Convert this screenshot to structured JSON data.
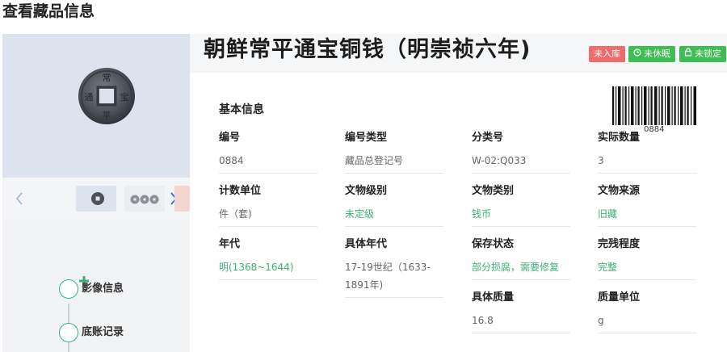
{
  "page": {
    "title": "查看藏品信息"
  },
  "item": {
    "title": "朝鲜常平通宝铜钱（明崇祯六年)",
    "badges": [
      {
        "label": "未入库",
        "color": "#f06b6b"
      },
      {
        "label": "未休眠",
        "color": "#3dbd53",
        "icon": "clock-icon"
      },
      {
        "label": "未锁定",
        "color": "#3dbd53",
        "icon": "lock-icon"
      }
    ]
  },
  "gallery": {
    "prev_icon": "chevron-left-icon",
    "next_icon": "chevron-right-icon"
  },
  "timeline": {
    "add_icon": "plus-icon",
    "items": [
      {
        "label": "影像信息"
      },
      {
        "label": "底账记录"
      }
    ]
  },
  "basic_info": {
    "section_title": "基本信息",
    "barcode_number": "0884",
    "fields": [
      {
        "label": "编号",
        "value": "0884"
      },
      {
        "label": "编号类型",
        "value": "藏品总登记号"
      },
      {
        "label": "分类号",
        "value": "W-02:Q033"
      },
      {
        "label": "实际数量",
        "value": "3"
      },
      {
        "label": "计数单位",
        "value": "件（套)"
      },
      {
        "label": "文物级别",
        "value": "未定级"
      },
      {
        "label": "文物类别",
        "value": "钱币"
      },
      {
        "label": "文物来源",
        "value": "旧藏"
      },
      {
        "label": "年代",
        "value": "明(1368~1644)"
      },
      {
        "label": "具体年代",
        "value": "17-19世纪（1633-1891年)"
      },
      {
        "label": "保存状态",
        "value": "部分损腐，需要修复"
      },
      {
        "label": "完残程度",
        "value": "完整"
      },
      {
        "label": "具体质量",
        "value": "16.8"
      },
      {
        "label": "质量单位",
        "value": "g"
      }
    ]
  }
}
